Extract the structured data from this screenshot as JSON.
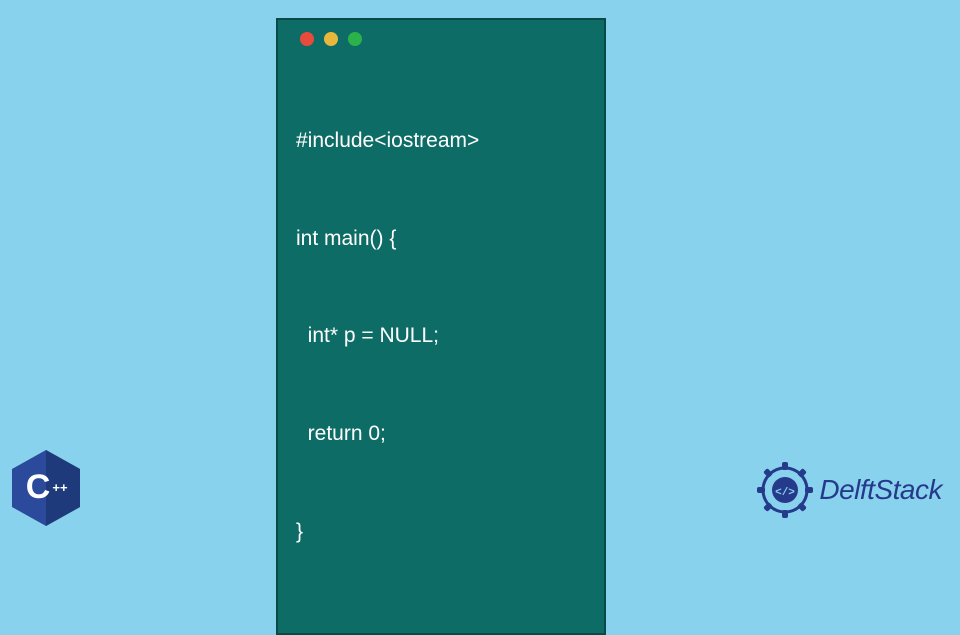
{
  "code": {
    "lines": [
      "#include<iostream>",
      "int main() {",
      "  int* p = NULL;",
      "  return 0;",
      "}"
    ]
  },
  "traffic_lights": {
    "red": "#e84b3c",
    "yellow": "#e8b83c",
    "green": "#2cb24a"
  },
  "cpp_logo": {
    "label": "C++",
    "plus": "++",
    "letter": "C",
    "bg": "#2b4a9c"
  },
  "brand": {
    "name": "DelftStack",
    "icon_glyph": "</>",
    "color": "#253a8b"
  }
}
